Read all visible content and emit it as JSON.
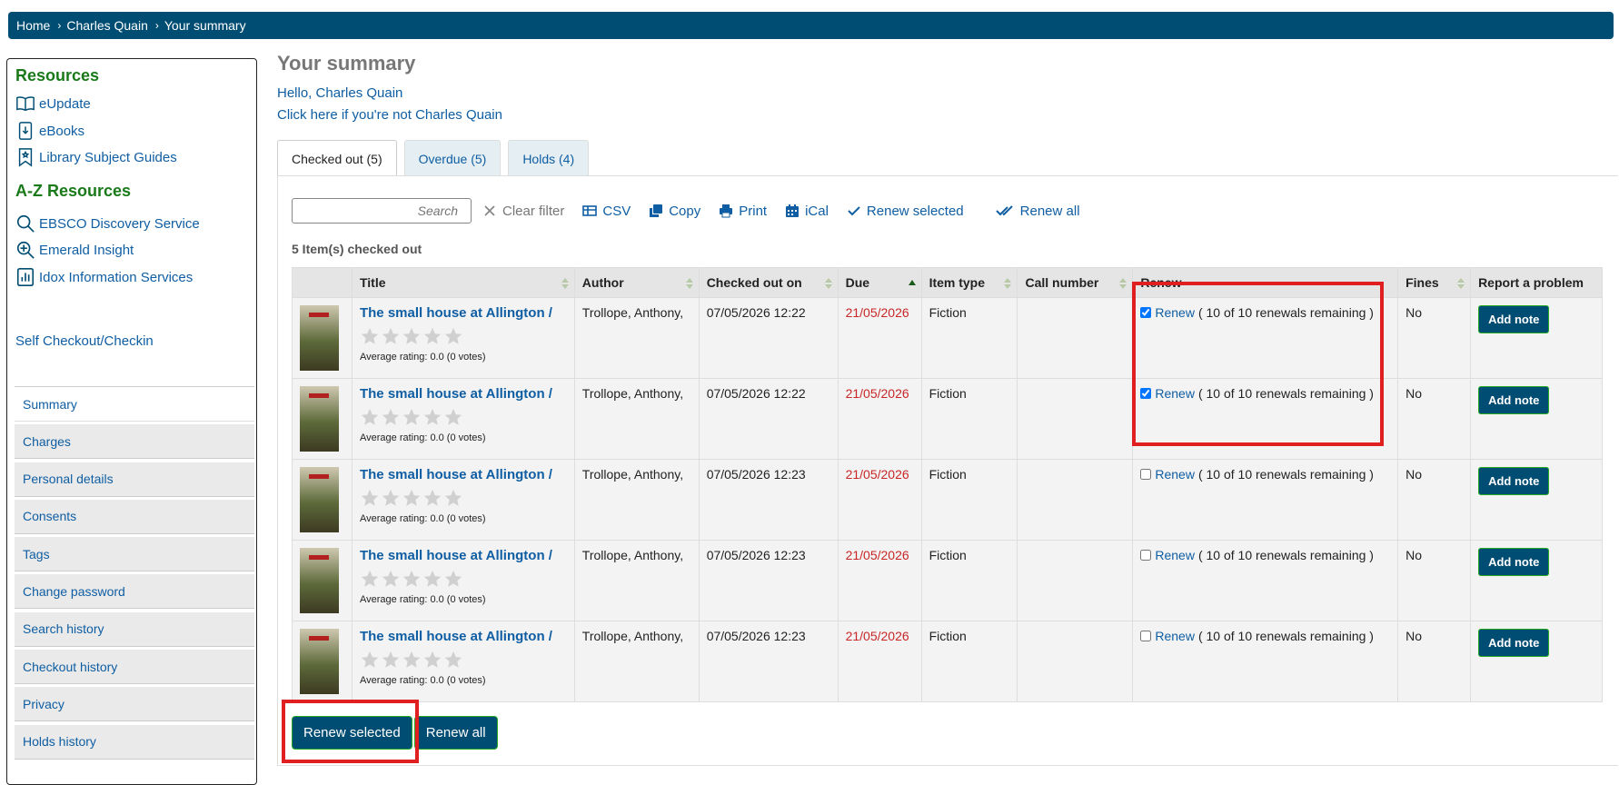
{
  "breadcrumb": {
    "home": "Home",
    "user": "Charles Quain",
    "current": "Your summary",
    "sep": "›"
  },
  "sidebar": {
    "resources_heading": "Resources",
    "resources": [
      {
        "label": "eUpdate",
        "icon": "book-open-icon"
      },
      {
        "label": "eBooks",
        "icon": "download-file-icon"
      },
      {
        "label": "Library Subject Guides",
        "icon": "bookmark-icon"
      }
    ],
    "az_heading": "A-Z Resources",
    "az": [
      {
        "label": "EBSCO Discovery Service",
        "icon": "search-icon"
      },
      {
        "label": "Emerald Insight",
        "icon": "zoom-in-icon"
      },
      {
        "label": "Idox Information Services",
        "icon": "bar-chart-icon"
      }
    ],
    "self_checkout": "Self Checkout/Checkin",
    "menu": [
      "Summary",
      "Charges",
      "Personal details",
      "Consents",
      "Tags",
      "Change password",
      "Search history",
      "Checkout history",
      "Privacy",
      "Holds history"
    ]
  },
  "main": {
    "title": "Your summary",
    "hello": "Hello, Charles Quain",
    "not_me": "Click here if you're not Charles Quain",
    "tabs": [
      "Checked out (5)",
      "Overdue (5)",
      "Holds (4)"
    ],
    "search_placeholder": "Search",
    "toolbar": {
      "clear": "Clear filter",
      "csv": "CSV",
      "copy": "Copy",
      "print": "Print",
      "ical": "iCal",
      "renew_selected": "Renew selected",
      "renew_all": "Renew all"
    },
    "count": "5 Item(s) checked out",
    "columns": [
      "",
      "Title",
      "Author",
      "Checked out on",
      "Due",
      "Item type",
      "Call number",
      "Renew",
      "Fines",
      "Report a problem"
    ],
    "rows": [
      {
        "title": "The small house at Allington /",
        "rating": "Average rating: 0.0 (0 votes)",
        "author": "Trollope, Anthony,",
        "checked_out": "07/05/2026 12:22",
        "due": "21/05/2026",
        "type": "Fiction",
        "call": "",
        "checked": true,
        "renew": "Renew",
        "renew_info": "( 10 of 10 renewals remaining )",
        "fines": "No",
        "note": "Add note"
      },
      {
        "title": "The small house at Allington /",
        "rating": "Average rating: 0.0 (0 votes)",
        "author": "Trollope, Anthony,",
        "checked_out": "07/05/2026 12:22",
        "due": "21/05/2026",
        "type": "Fiction",
        "call": "",
        "checked": true,
        "renew": "Renew",
        "renew_info": "( 10 of 10 renewals remaining )",
        "fines": "No",
        "note": "Add note"
      },
      {
        "title": "The small house at Allington /",
        "rating": "Average rating: 0.0 (0 votes)",
        "author": "Trollope, Anthony,",
        "checked_out": "07/05/2026 12:23",
        "due": "21/05/2026",
        "type": "Fiction",
        "call": "",
        "checked": false,
        "renew": "Renew",
        "renew_info": "( 10 of 10 renewals remaining )",
        "fines": "No",
        "note": "Add note"
      },
      {
        "title": "The small house at Allington /",
        "rating": "Average rating: 0.0 (0 votes)",
        "author": "Trollope, Anthony,",
        "checked_out": "07/05/2026 12:23",
        "due": "21/05/2026",
        "type": "Fiction",
        "call": "",
        "checked": false,
        "renew": "Renew",
        "renew_info": "( 10 of 10 renewals remaining )",
        "fines": "No",
        "note": "Add note"
      },
      {
        "title": "The small house at Allington /",
        "rating": "Average rating: 0.0 (0 votes)",
        "author": "Trollope, Anthony,",
        "checked_out": "07/05/2026 12:23",
        "due": "21/05/2026",
        "type": "Fiction",
        "call": "",
        "checked": false,
        "renew": "Renew",
        "renew_info": "( 10 of 10 renewals remaining )",
        "fines": "No",
        "note": "Add note"
      }
    ],
    "bottom": {
      "renew_selected": "Renew selected",
      "renew_all": "Renew all"
    }
  },
  "colors": {
    "brand": "#004d73",
    "link": "#0f5ea3",
    "heading_green": "#1a7a1a",
    "due_red": "#c82626",
    "highlight": "#e02020"
  }
}
